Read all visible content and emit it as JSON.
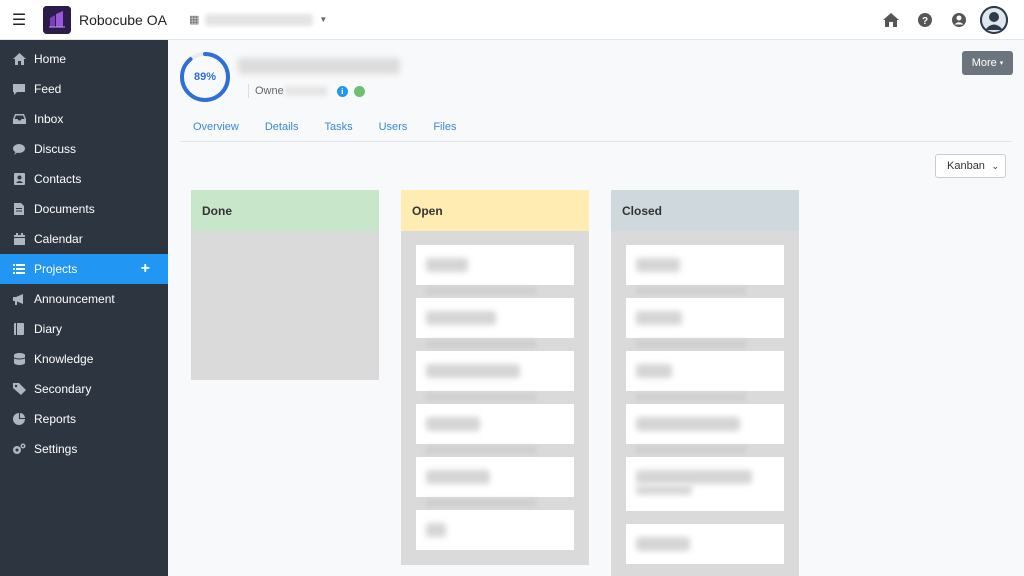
{
  "app": {
    "name": "Robocube OA"
  },
  "sidebar": {
    "items": [
      {
        "label": "Home",
        "icon": "home-icon"
      },
      {
        "label": "Feed",
        "icon": "comment-icon"
      },
      {
        "label": "Inbox",
        "icon": "inbox-icon"
      },
      {
        "label": "Discuss",
        "icon": "chat-icon"
      },
      {
        "label": "Contacts",
        "icon": "contact-book-icon"
      },
      {
        "label": "Documents",
        "icon": "document-icon"
      },
      {
        "label": "Calendar",
        "icon": "calendar-icon"
      },
      {
        "label": "Projects",
        "icon": "list-icon",
        "active": true
      },
      {
        "label": "Announcement",
        "icon": "megaphone-icon"
      },
      {
        "label": "Diary",
        "icon": "book-icon"
      },
      {
        "label": "Knowledge",
        "icon": "database-icon"
      },
      {
        "label": "Secondary",
        "icon": "tag-icon"
      },
      {
        "label": "Reports",
        "icon": "pie-chart-icon"
      },
      {
        "label": "Settings",
        "icon": "gears-icon"
      }
    ],
    "add_symbol": "+"
  },
  "project": {
    "progress_label": "89%",
    "progress_fraction": 0.89,
    "owner_label": "Owne"
  },
  "header": {
    "more_label": "More",
    "caret": "▾"
  },
  "tabs": [
    "Overview",
    "Details",
    "Tasks",
    "Users",
    "Files"
  ],
  "view_select": {
    "value": "Kanban",
    "caret": "⌄"
  },
  "kanban": {
    "columns": [
      {
        "title": "Done",
        "color": "#c8e6c9"
      },
      {
        "title": "Open",
        "color": "#ffecb3"
      },
      {
        "title": "Closed",
        "color": "#cfd8dc"
      }
    ]
  },
  "colors": {
    "accent": "#2196f3",
    "sidebar": "#2d3640",
    "progress": "#2d6fd6"
  }
}
